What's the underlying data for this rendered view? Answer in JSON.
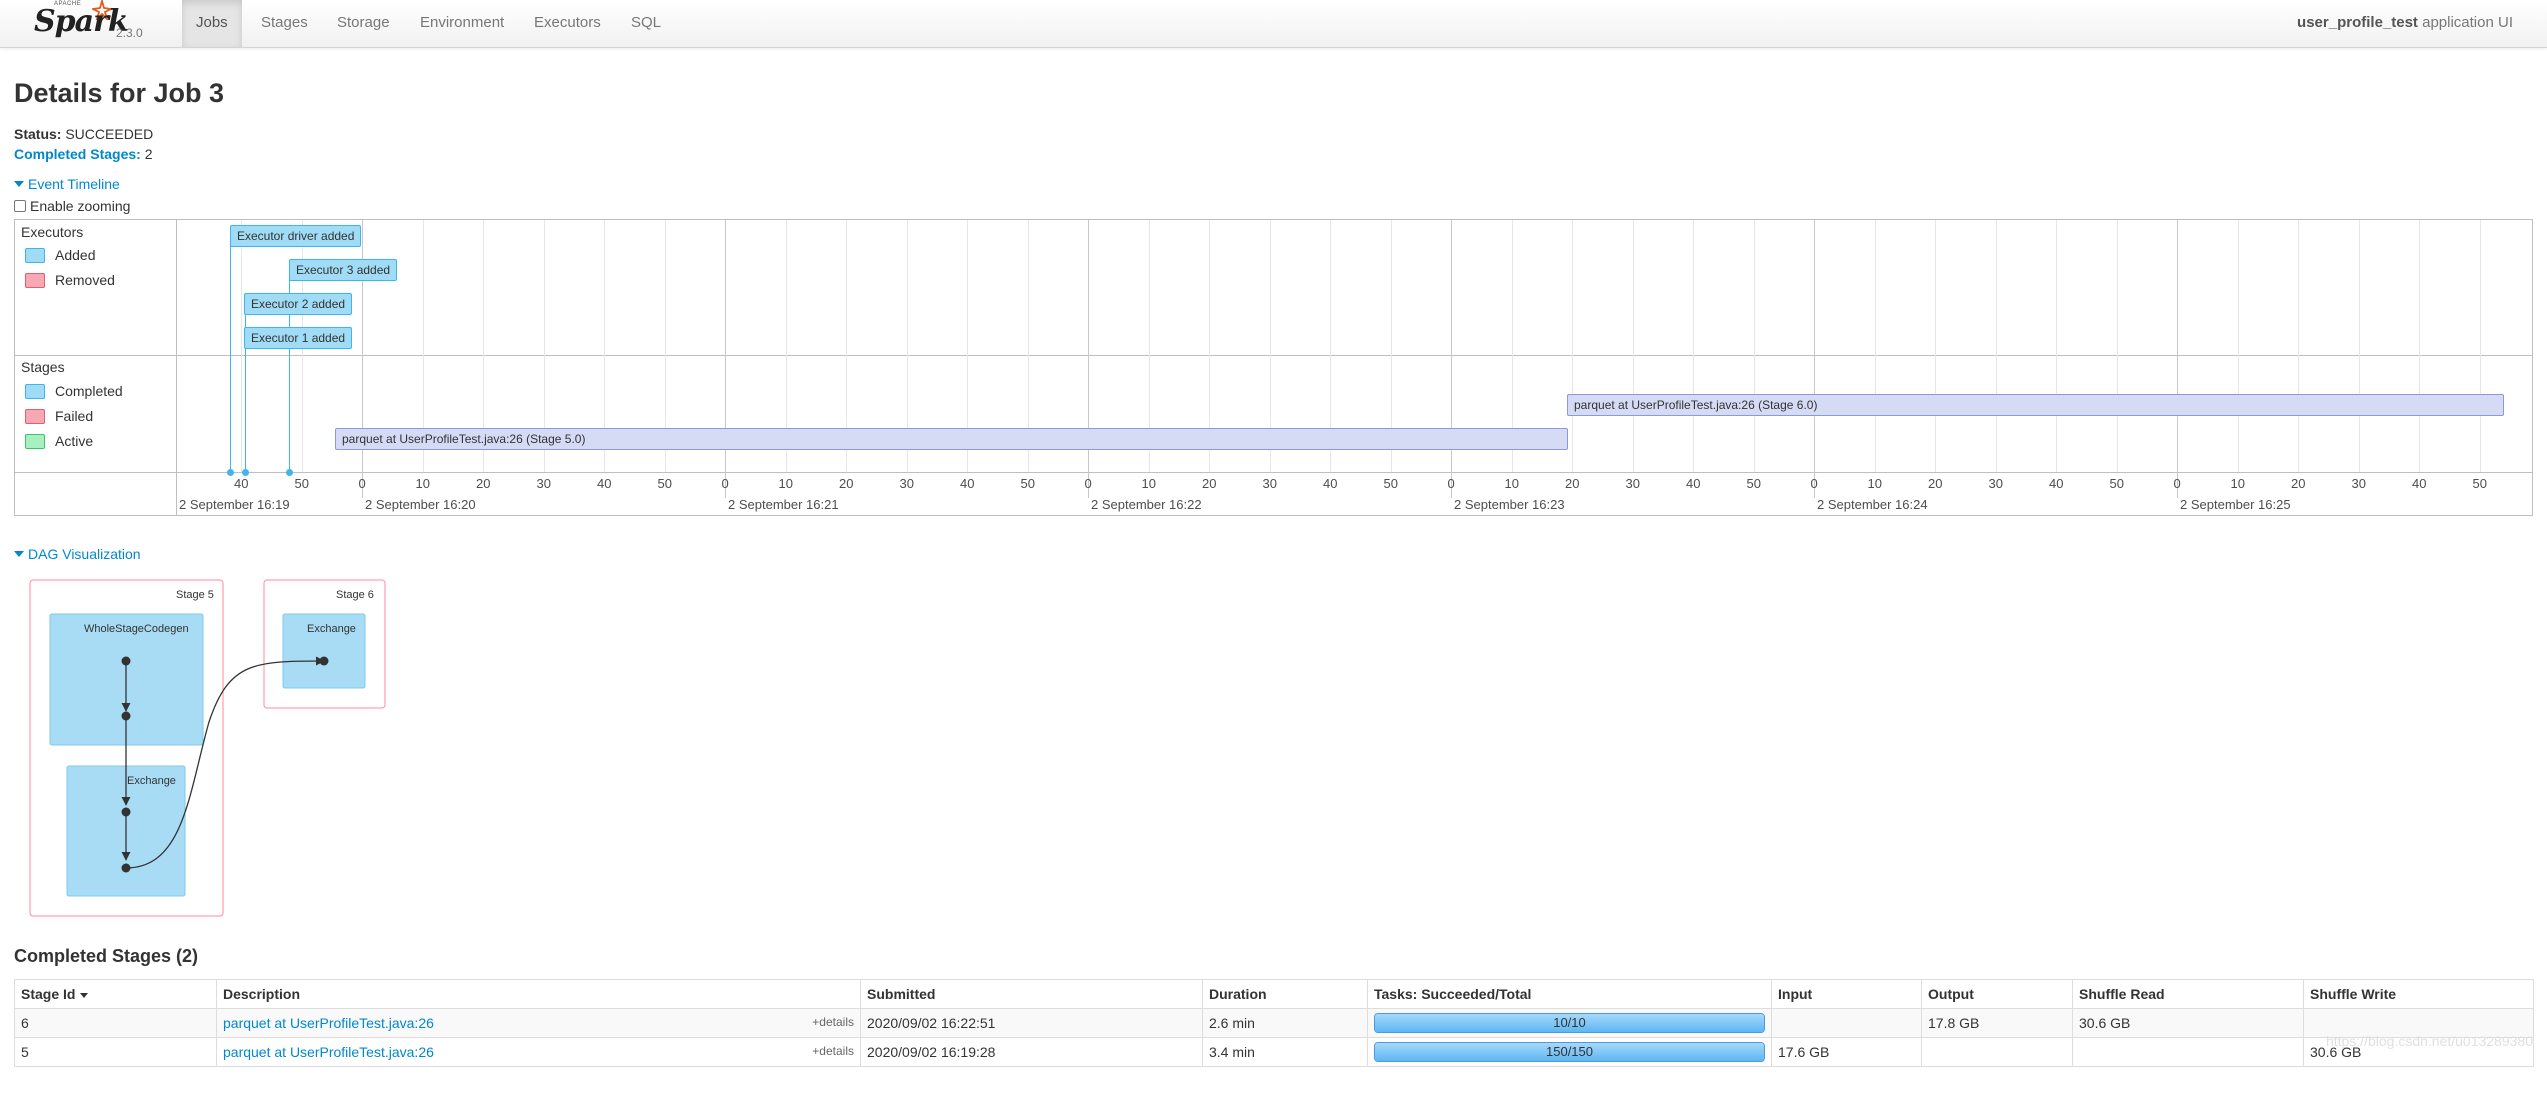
{
  "nav": {
    "logo_text": "Spark",
    "logo_small": "APACHE",
    "version": "2.3.0",
    "tabs": [
      {
        "label": "Jobs",
        "active": true
      },
      {
        "label": "Stages",
        "active": false
      },
      {
        "label": "Storage",
        "active": false
      },
      {
        "label": "Environment",
        "active": false
      },
      {
        "label": "Executors",
        "active": false
      },
      {
        "label": "SQL",
        "active": false
      }
    ],
    "app_name": "user_profile_test",
    "app_suffix": "application UI"
  },
  "page": {
    "title": "Details for Job 3",
    "status_label": "Status:",
    "status_value": "SUCCEEDED",
    "completed_label": "Completed Stages:",
    "completed_value": "2"
  },
  "timeline": {
    "toggle_label": "Event Timeline",
    "zoom_label": "Enable zooming",
    "executors_title": "Executors",
    "executor_legend": [
      {
        "label": "Added",
        "color": "#a0dcf5",
        "border": "#3eb5ec"
      },
      {
        "label": "Removed",
        "color": "#f7a8b4",
        "border": "#e06070"
      }
    ],
    "stages_title": "Stages",
    "stage_legend": [
      {
        "label": "Completed",
        "color": "#a0dcf5",
        "border": "#3eb5ec"
      },
      {
        "label": "Failed",
        "color": "#f7a8b4",
        "border": "#e06070"
      },
      {
        "label": "Active",
        "color": "#a8f0c0",
        "border": "#40c070"
      }
    ],
    "executor_events": [
      {
        "label": "Executor driver added"
      },
      {
        "label": "Executor 3 added"
      },
      {
        "label": "Executor 2 added"
      },
      {
        "label": "Executor 1 added"
      }
    ],
    "stage_bars": [
      {
        "label": "parquet at UserProfileTest.java:26 (Stage 6.0)"
      },
      {
        "label": "parquet at UserProfileTest.java:26 (Stage 5.0)"
      }
    ],
    "minute_labels": [
      "2 September 16:19",
      "2 September 16:20",
      "2 September 16:21",
      "2 September 16:22",
      "2 September 16:23",
      "2 September 16:24",
      "2 September 16:25"
    ],
    "second_labels": [
      "0",
      "10",
      "20",
      "30",
      "40",
      "50"
    ]
  },
  "dag": {
    "toggle_label": "DAG Visualization",
    "stage5_label": "Stage 5",
    "stage6_label": "Stage 6",
    "wsc_label": "WholeStageCodegen",
    "exchange5_label": "Exchange",
    "exchange6_label": "Exchange",
    "cluster_border": "#ff8aa0",
    "node_fill": "#a8dcf5",
    "node_border": "#7cc8ee"
  },
  "stages_table": {
    "title": "Completed Stages (2)",
    "headers": [
      "Stage Id",
      "Description",
      "Submitted",
      "Duration",
      "Tasks: Succeeded/Total",
      "Input",
      "Output",
      "Shuffle Read",
      "Shuffle Write"
    ],
    "rows": [
      {
        "id": "6",
        "description": "parquet at UserProfileTest.java:26",
        "details": "+details",
        "submitted": "2020/09/02 16:22:51",
        "duration": "2.6 min",
        "tasks": "10/10",
        "tasks_fraction": 1.0,
        "input": "",
        "output": "17.8 GB",
        "shuffle_read": "30.6 GB",
        "shuffle_write": ""
      },
      {
        "id": "5",
        "description": "parquet at UserProfileTest.java:26",
        "details": "+details",
        "submitted": "2020/09/02 16:19:28",
        "duration": "3.4 min",
        "tasks": "150/150",
        "tasks_fraction": 1.0,
        "input": "17.6 GB",
        "output": "",
        "shuffle_read": "",
        "shuffle_write": "30.6 GB"
      }
    ]
  },
  "watermark": "https://blog.csdn.net/u013289380"
}
